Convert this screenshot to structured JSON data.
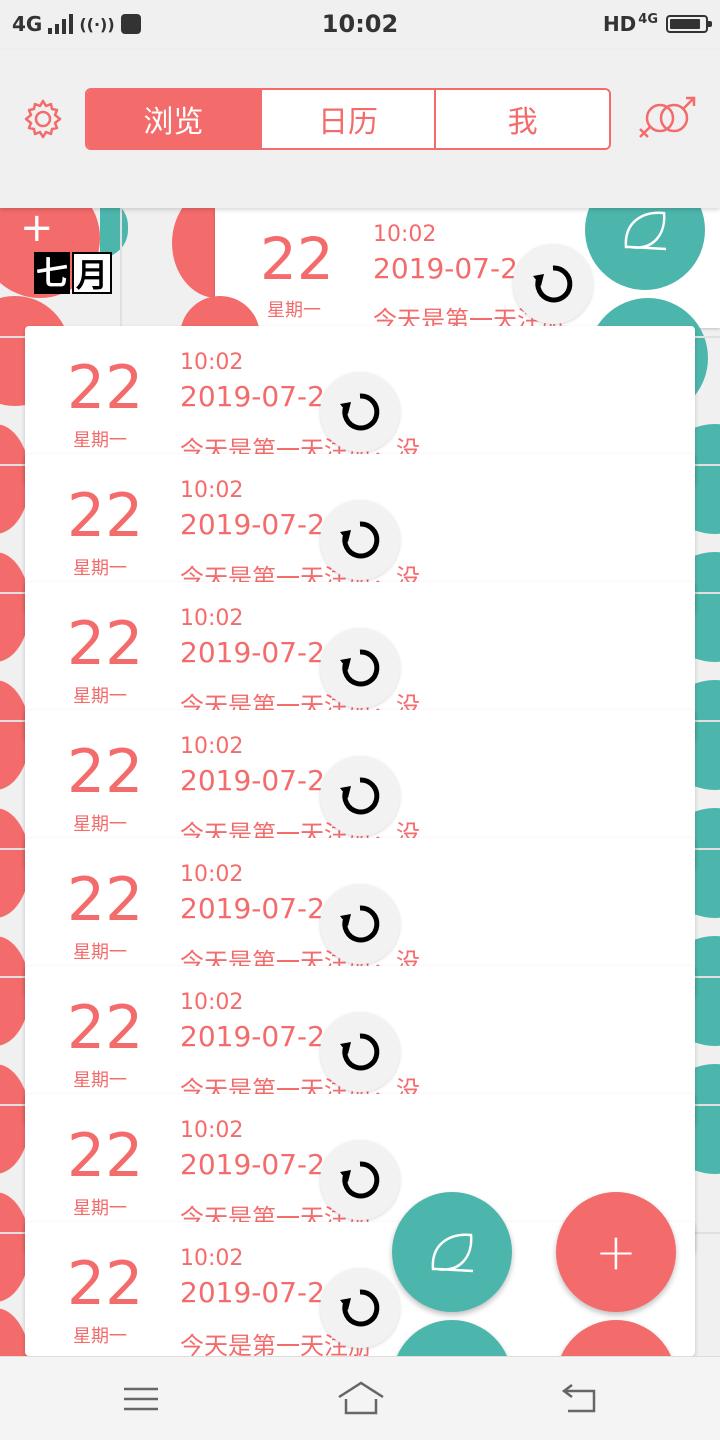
{
  "status_bar": {
    "network": "4G",
    "time": "10:02",
    "hd": "HD",
    "network_right": "4G"
  },
  "header": {
    "tabs": [
      {
        "label": "浏览",
        "active": true
      },
      {
        "label": "日历",
        "active": false
      },
      {
        "label": "我",
        "active": false
      }
    ],
    "left_icon": "settings-gear-icon",
    "right_icon": "gender-symbol-icon"
  },
  "background": {
    "month_label": [
      "七",
      "月"
    ]
  },
  "cards": [
    {
      "day": "22",
      "weekday": "星期一",
      "time": "10:02",
      "date": "2019-07-2",
      "snippet": "今天是第一天注册，没..."
    },
    {
      "day": "22",
      "weekday": "星期一",
      "time": "10:02",
      "date": "2019-07-2",
      "snippet": "今天是第一天注册，没..."
    },
    {
      "day": "22",
      "weekday": "星期一",
      "time": "10:02",
      "date": "2019-07-2",
      "snippet": "今天是第一天注册，没..."
    },
    {
      "day": "22",
      "weekday": "星期一",
      "time": "10:02",
      "date": "2019-07-2",
      "snippet": "今天是第一天注册，没..."
    },
    {
      "day": "22",
      "weekday": "星期一",
      "time": "10:02",
      "date": "2019-07-2",
      "snippet": "今天是第一天注册，没..."
    },
    {
      "day": "22",
      "weekday": "星期一",
      "time": "10:02",
      "date": "2019-07-2",
      "snippet": "今天是第一天注册，没..."
    },
    {
      "day": "22",
      "weekday": "星期一",
      "time": "10:02",
      "date": "2019-07-2",
      "snippet": "今天是第一天注册"
    },
    {
      "day": "22",
      "weekday": "星期一",
      "time": "10:02",
      "date": "2019-07-2",
      "snippet": "今天是第一天注册"
    }
  ],
  "top_partial_card": {
    "day": "22",
    "weekday": "星期一",
    "time": "10:02",
    "date": "2019-07-2",
    "snippet": "今天是第一天注册"
  },
  "fabs": {
    "leaf_icon": "leaf-icon",
    "add_icon": "plus-icon"
  },
  "colors": {
    "accent": "#f46b6b",
    "teal": "#4db6ac"
  }
}
